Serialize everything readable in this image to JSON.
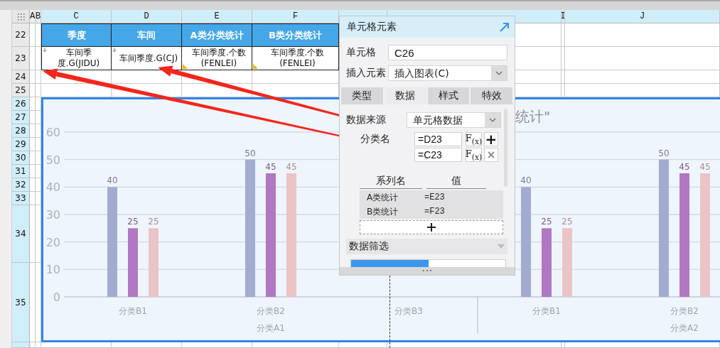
{
  "sheet": {
    "column_headers": [
      {
        "label": "A",
        "selected": false
      },
      {
        "label": "B",
        "selected": false
      },
      {
        "label": "C",
        "selected": true
      },
      {
        "label": "D",
        "selected": true
      },
      {
        "label": "E",
        "selected": true
      },
      {
        "label": "F",
        "selected": true
      },
      {
        "selected": true
      },
      {
        "selected": true
      },
      {
        "label": "I",
        "selected": true
      },
      {
        "label": "J",
        "selected": true
      }
    ],
    "rows": [
      {
        "number": "22",
        "selected": false
      },
      {
        "number": "23",
        "selected": false
      },
      {
        "number": "24",
        "selected": false
      },
      {
        "number": "25",
        "selected": false
      },
      {
        "number": "26",
        "selected": true
      },
      {
        "number": "27",
        "selected": true
      },
      {
        "number": "28",
        "selected": true
      },
      {
        "number": "29",
        "selected": true
      },
      {
        "number": "30",
        "selected": true
      },
      {
        "number": "31",
        "selected": true
      },
      {
        "number": "32",
        "selected": true
      },
      {
        "number": "33",
        "selected": true
      },
      {
        "number": "34",
        "selected": true
      },
      {
        "number": "35",
        "selected": true
      }
    ],
    "header_row": [
      "季度",
      "车间",
      "A类分类统计",
      "B类分类统计"
    ],
    "data_row": [
      {
        "text": "车间季度.G(JIDU)",
        "kind": "group"
      },
      {
        "text": "车间季度.G(CJ)",
        "kind": "group"
      },
      {
        "text": "车间季度.个数(FENLEI)",
        "kind": "summary"
      },
      {
        "text": "车间季度.个数(FENLEI)",
        "kind": "summary"
      }
    ]
  },
  "chart": {
    "category_groups": [
      "分类A1",
      "分类A2"
    ],
    "chart_data": {
      "type": "bar",
      "title": "统计\"",
      "categories": [
        "分类B1",
        "分类B2",
        "分类B3",
        "分类B1",
        "分类B2"
      ],
      "series": [
        {
          "color": "#a4abd0",
          "values": [
            40,
            50,
            null,
            40,
            50
          ]
        },
        {
          "color": "#b277c2",
          "values": [
            25,
            45,
            null,
            25,
            45
          ]
        },
        {
          "color": "#ebc4c6",
          "values": [
            25,
            45,
            null,
            25,
            45
          ]
        }
      ],
      "ylim": [
        0,
        60
      ],
      "yticks": [
        0,
        10,
        20,
        30,
        40,
        50,
        60
      ],
      "grid": true,
      "data_labels": true
    }
  },
  "panel": {
    "title": "单元格元素",
    "cell_label": "单元格",
    "cell_value": "C26",
    "insert_label": "插入元素",
    "insert_value": "插入图表(C)",
    "tabs": [
      {
        "label": "类型",
        "selected": false
      },
      {
        "label": "数据",
        "selected": true
      },
      {
        "label": "样式",
        "selected": false
      },
      {
        "label": "特效",
        "selected": false
      }
    ],
    "source_label": "数据来源",
    "source_value": "单元格数据",
    "category_label": "分类名",
    "category_fields": [
      {
        "value": "=D23",
        "fx": "F$_{(x)}$",
        "kind": "add",
        "symbol": "+"
      },
      {
        "value": "=C23",
        "fx": "F$_{(x)}$",
        "kind": "remove",
        "symbol": "×"
      }
    ],
    "series_header": [
      "系列名",
      "值"
    ],
    "series": [
      {
        "name": "A类统计",
        "value": "=E23"
      },
      {
        "name": "B类统计",
        "value": "=F23"
      }
    ],
    "filter_label": "数据筛选"
  }
}
